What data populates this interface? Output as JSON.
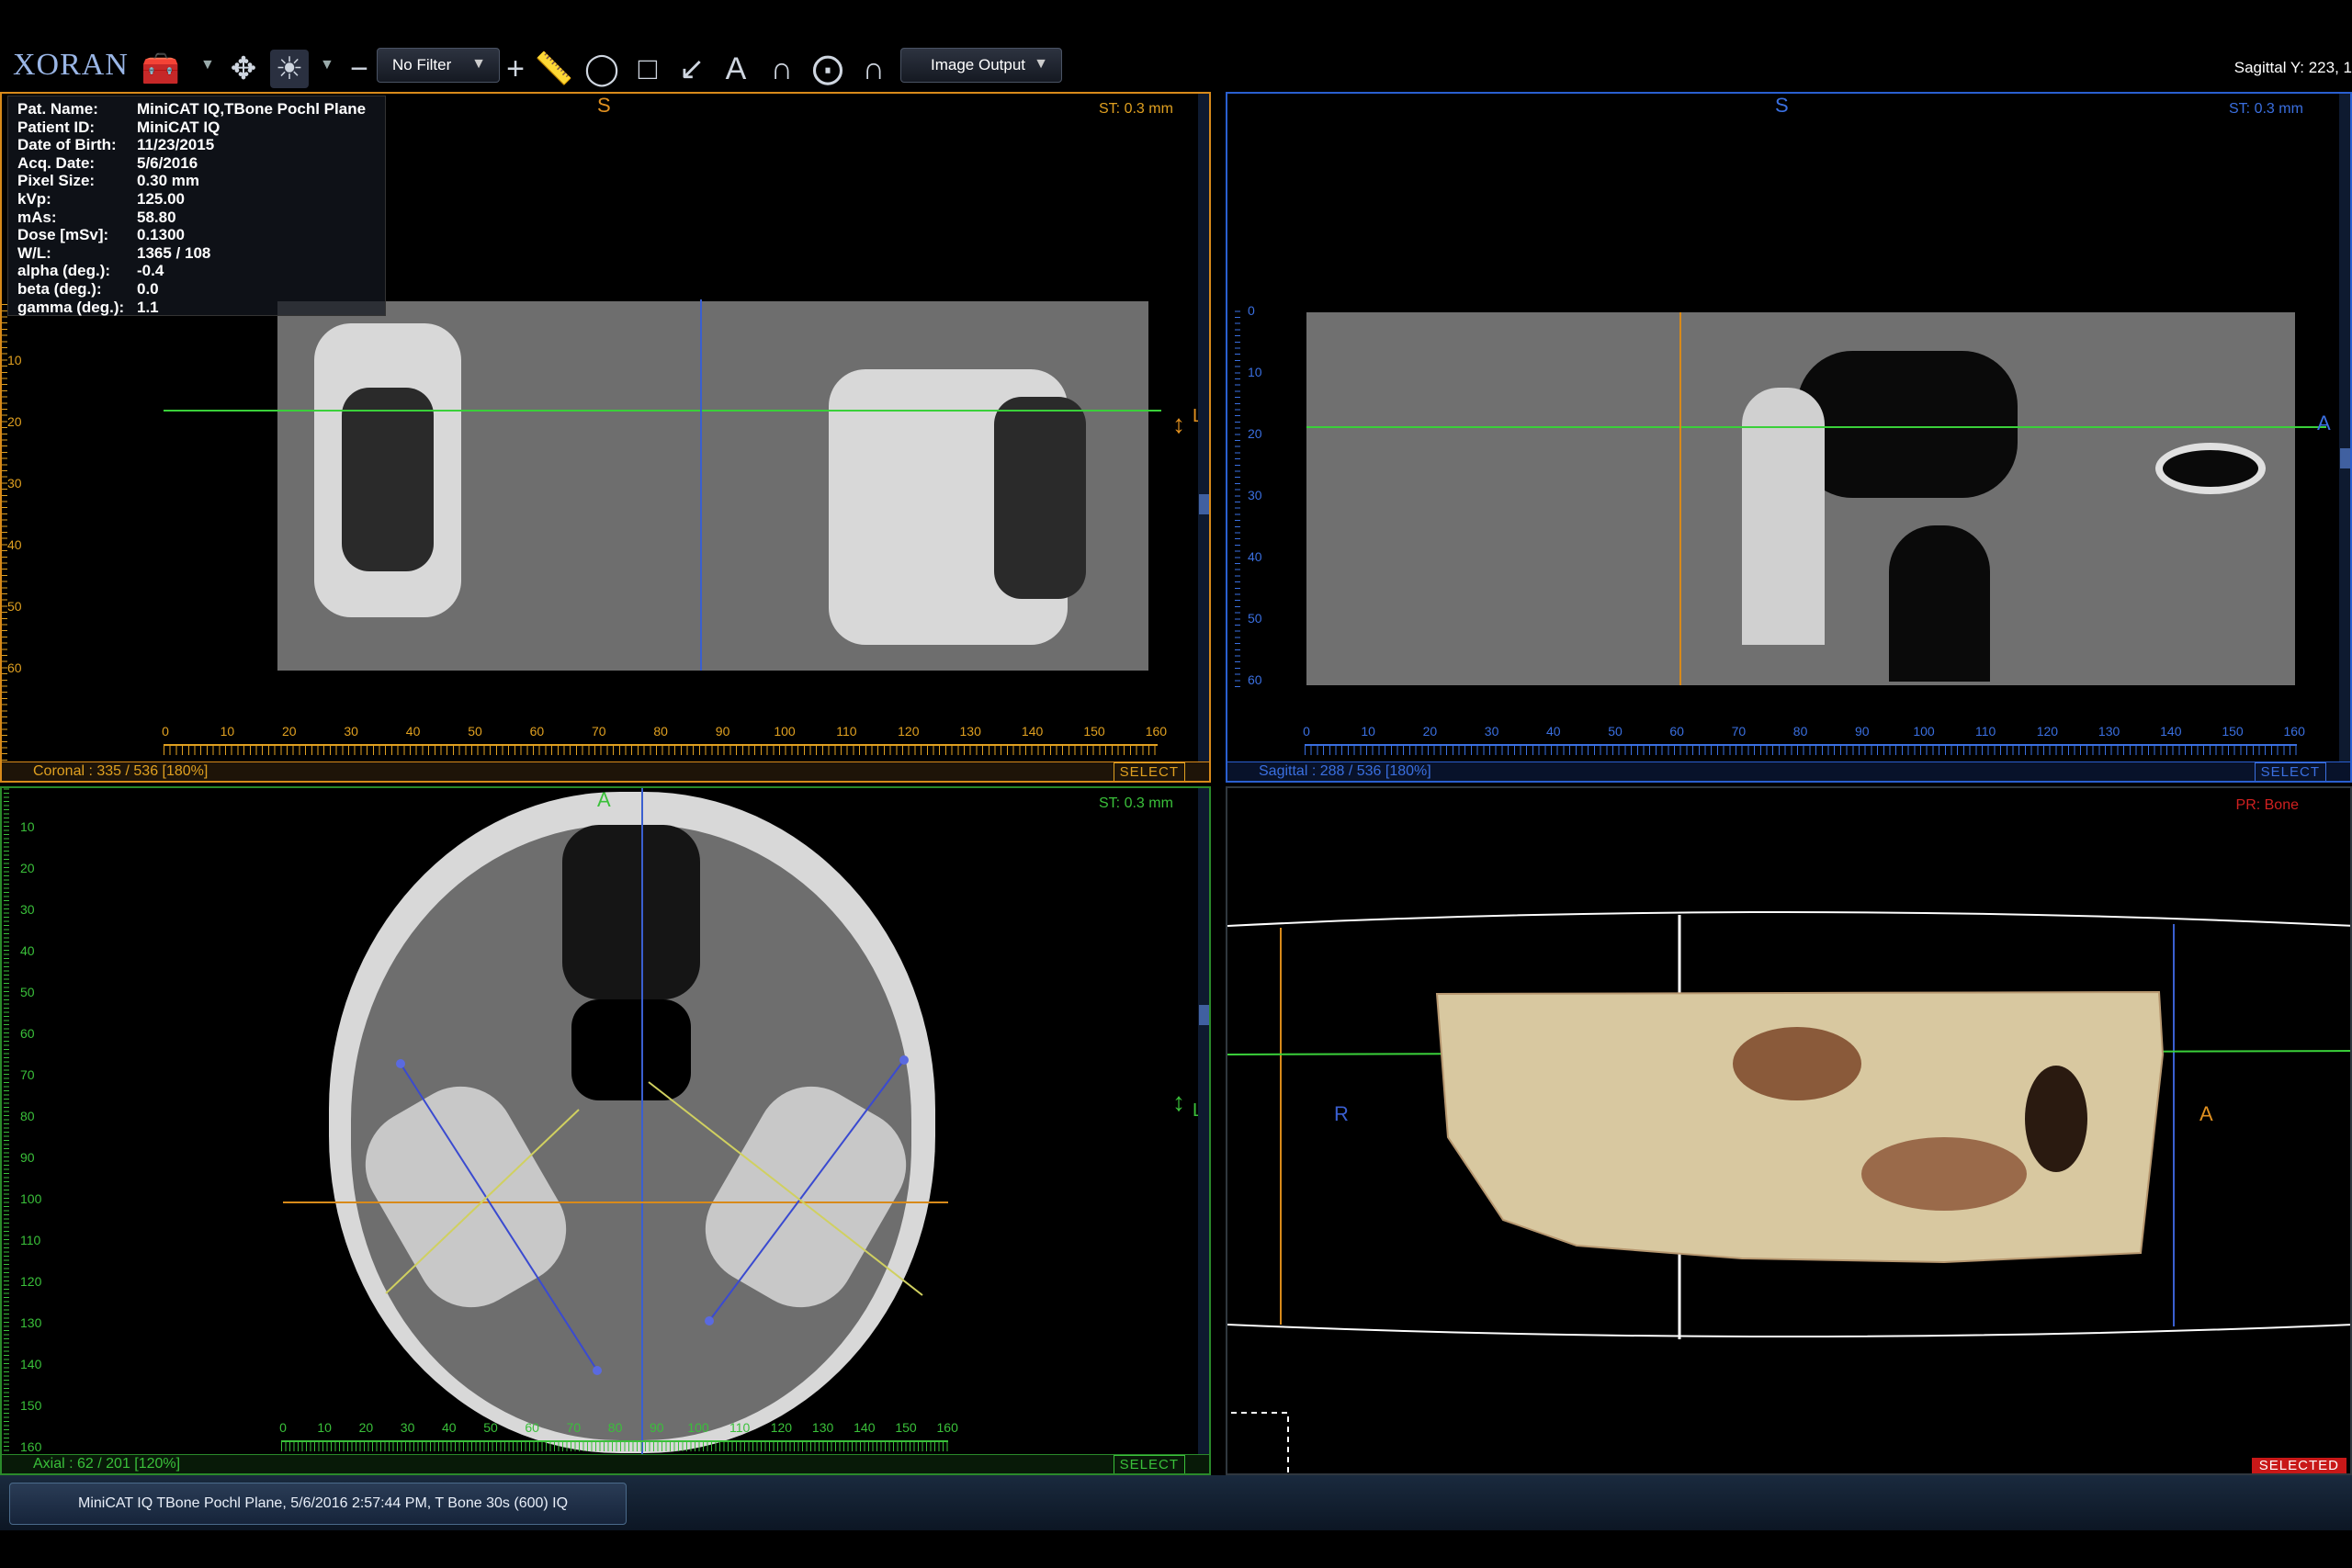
{
  "toolbar": {
    "logo": "XORAN",
    "filter_label": "No Filter",
    "output_label": "Image Output",
    "status_right": "Sagittal Y: 223, 1",
    "icons": [
      "toolbox-icon",
      "pan-icon",
      "window-level-icon",
      "ruler-icon",
      "circle-roi-icon",
      "rectangle-roi-icon",
      "arrow-annotation-icon",
      "text-annotation-icon",
      "angle-icon",
      "curve-icon",
      "arch-icon"
    ]
  },
  "patient_info": [
    {
      "key": "Pat. Name:",
      "value": "MiniCAT IQ,TBone Pochl Plane"
    },
    {
      "key": "Patient ID:",
      "value": "MiniCAT IQ"
    },
    {
      "key": "Date of Birth:",
      "value": "11/23/2015"
    },
    {
      "key": "Acq. Date:",
      "value": "5/6/2016"
    },
    {
      "key": "Pixel Size:",
      "value": "0.30 mm"
    },
    {
      "key": "kVp:",
      "value": "125.00"
    },
    {
      "key": "mAs:",
      "value": "58.80"
    },
    {
      "key": "Dose [mSv]:",
      "value": "0.1300"
    },
    {
      "key": "W/L:",
      "value": "1365 / 108"
    },
    {
      "key": "alpha (deg.):",
      "value": "-0.4"
    },
    {
      "key": "beta (deg.):",
      "value": "0.0"
    },
    {
      "key": "gamma (deg.):",
      "value": "1.1"
    }
  ],
  "viewports": {
    "coronal": {
      "label": "Coronal : 335 / 536 [180%]",
      "select": "SELECT",
      "slice_thickness": "ST:  0.3 mm",
      "top_orient": "S",
      "side_orient": "L",
      "xticks": [
        "0",
        "10",
        "20",
        "30",
        "40",
        "50",
        "60",
        "70",
        "80",
        "90",
        "100",
        "110",
        "120",
        "130",
        "140",
        "150",
        "160"
      ],
      "yticks": [
        "10",
        "20",
        "30",
        "40",
        "50",
        "60"
      ]
    },
    "sagittal": {
      "label": "Sagittal : 288 / 536 [180%]",
      "select": "SELECT",
      "slice_thickness": "ST:  0.3 mm",
      "top_orient": "S",
      "side_orient": "A",
      "xticks": [
        "0",
        "10",
        "20",
        "30",
        "40",
        "50",
        "60",
        "70",
        "80",
        "90",
        "100",
        "110",
        "120",
        "130",
        "140",
        "150",
        "160"
      ],
      "yticks": [
        "0",
        "10",
        "20",
        "30",
        "40",
        "50",
        "60"
      ]
    },
    "axial": {
      "label": "Axial : 62 / 201 [120%]",
      "select": "SELECT",
      "slice_thickness": "ST:  0.3 mm",
      "top_orient": "A",
      "side_orient": "L",
      "xticks": [
        "0",
        "10",
        "20",
        "30",
        "40",
        "50",
        "60",
        "70",
        "80",
        "90",
        "100",
        "110",
        "120",
        "130",
        "140",
        "150",
        "160"
      ],
      "yticks": [
        "10",
        "20",
        "30",
        "40",
        "50",
        "60",
        "70",
        "80",
        "90",
        "100",
        "110",
        "120",
        "130",
        "140",
        "150",
        "160"
      ]
    },
    "render3d": {
      "preset": "PR: Bone",
      "left_orient": "R",
      "right_orient": "A",
      "selected": "SELECTED"
    }
  },
  "taskbar": {
    "item": "MiniCAT IQ TBone Pochl Plane, 5/6/2016 2:57:44 PM, T Bone 30s (600) IQ"
  },
  "colors": {
    "coronal": "#d88a1a",
    "sagittal": "#2a5fd0",
    "axial": "#2a8a2a",
    "tick_coronal": "#e0a020",
    "tick_sagittal": "#3a6fe0",
    "tick_axial": "#3ac03a",
    "crosshair_green": "#3ad03a"
  }
}
